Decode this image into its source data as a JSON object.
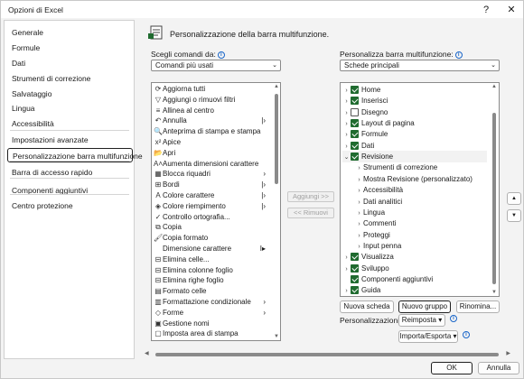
{
  "window": {
    "title": "Opzioni di Excel",
    "help_glyph": "?",
    "close_glyph": "✕"
  },
  "sidebar": {
    "items": [
      {
        "label": "Generale"
      },
      {
        "label": "Formule"
      },
      {
        "label": "Dati"
      },
      {
        "label": "Strumenti di correzione"
      },
      {
        "label": "Salvataggio"
      },
      {
        "label": "Lingua"
      },
      {
        "label": "Accessibilità"
      },
      {
        "label": "Impostazioni avanzate"
      },
      {
        "label": "Personalizzazione barra multifunzione"
      },
      {
        "label": "Barra di accesso rapido"
      },
      {
        "label": "Componenti aggiuntivi"
      },
      {
        "label": "Centro protezione"
      }
    ],
    "active_index": 8
  },
  "main": {
    "header": "Personalizzazione della barra multifunzione.",
    "left": {
      "label": "Scegli comandi da:",
      "combo_value": "Comandi più usati",
      "commands": [
        {
          "label": "Aggiorna tutti",
          "icon": "refresh-icon",
          "glyph": "⟳"
        },
        {
          "label": "Aggiungi o rimuovi filtri",
          "icon": "filter-icon",
          "glyph": "▽"
        },
        {
          "label": "Allinea al centro",
          "icon": "align-center-icon",
          "glyph": "≡"
        },
        {
          "label": "Annulla",
          "icon": "undo-icon",
          "glyph": "↶",
          "sub": "|›"
        },
        {
          "label": "Anteprima di stampa e stampa",
          "icon": "print-preview-icon",
          "glyph": "🔍"
        },
        {
          "label": "Apice",
          "icon": "superscript-icon",
          "glyph": "x²"
        },
        {
          "label": "Apri",
          "icon": "folder-icon",
          "glyph": "📂"
        },
        {
          "label": "Aumenta dimensioni carattere",
          "icon": "font-grow-icon",
          "glyph": "A˄"
        },
        {
          "label": "Blocca riquadri",
          "icon": "freeze-panes-icon",
          "glyph": "▦",
          "sub": "›"
        },
        {
          "label": "Bordi",
          "icon": "borders-icon",
          "glyph": "⊞",
          "sub": "|›"
        },
        {
          "label": "Colore carattere",
          "icon": "font-color-icon",
          "glyph": "A",
          "sub": "|›"
        },
        {
          "label": "Colore riempimento",
          "icon": "fill-color-icon",
          "glyph": "◈",
          "sub": "|›"
        },
        {
          "label": "Controllo ortografia...",
          "icon": "spelling-icon",
          "glyph": "✓"
        },
        {
          "label": "Copia",
          "icon": "copy-icon",
          "glyph": "⧉"
        },
        {
          "label": "Copia formato",
          "icon": "format-painter-icon",
          "glyph": "🖌"
        },
        {
          "label": "Dimensione carattere",
          "icon": "",
          "glyph": "",
          "sub": "I▸"
        },
        {
          "label": "Elimina celle...",
          "icon": "delete-cells-icon",
          "glyph": "⊟"
        },
        {
          "label": "Elimina colonne foglio",
          "icon": "delete-columns-icon",
          "glyph": "⊟"
        },
        {
          "label": "Elimina righe foglio",
          "icon": "delete-rows-icon",
          "glyph": "⊟"
        },
        {
          "label": "Formato celle",
          "icon": "format-cells-icon",
          "glyph": "▤"
        },
        {
          "label": "Formattazione condizionale",
          "icon": "conditional-format-icon",
          "glyph": "▥",
          "sub": "›"
        },
        {
          "label": "Forme",
          "icon": "shapes-icon",
          "glyph": "◇",
          "sub": "›"
        },
        {
          "label": "Gestione nomi",
          "icon": "name-manager-icon",
          "glyph": "▣"
        },
        {
          "label": "Imposta area di stampa",
          "icon": "print-area-icon",
          "glyph": "▢"
        }
      ]
    },
    "mid": {
      "add_label": "Aggiungi >>",
      "remove_label": "<< Rimuovi"
    },
    "right": {
      "label": "Personalizza barra multifunzione:",
      "combo_value": "Schede principali",
      "tree": [
        {
          "label": "Home",
          "checked": true,
          "level": 0,
          "exp": "›"
        },
        {
          "label": "Inserisci",
          "checked": true,
          "level": 0,
          "exp": "›"
        },
        {
          "label": "Disegno",
          "checked": false,
          "level": 0,
          "exp": "›"
        },
        {
          "label": "Layout di pagina",
          "checked": true,
          "level": 0,
          "exp": "›"
        },
        {
          "label": "Formule",
          "checked": true,
          "level": 0,
          "exp": "›"
        },
        {
          "label": "Dati",
          "checked": true,
          "level": 0,
          "exp": "›"
        },
        {
          "label": "Revisione",
          "checked": true,
          "level": 0,
          "exp": "⌄",
          "selected": true
        },
        {
          "label": "Strumenti di correzione",
          "level": 1,
          "exp": "›"
        },
        {
          "label": "Mostra Revisione (personalizzato)",
          "level": 1,
          "exp": "›"
        },
        {
          "label": "Accessibilità",
          "level": 1,
          "exp": "›"
        },
        {
          "label": "Dati analitici",
          "level": 1,
          "exp": "›"
        },
        {
          "label": "Lingua",
          "level": 1,
          "exp": "›"
        },
        {
          "label": "Commenti",
          "level": 1,
          "exp": "›"
        },
        {
          "label": "Proteggi",
          "level": 1,
          "exp": "›"
        },
        {
          "label": "Input penna",
          "level": 1,
          "exp": "›"
        },
        {
          "label": "Visualizza",
          "checked": true,
          "level": 0,
          "exp": "›"
        },
        {
          "label": "Sviluppo",
          "checked": true,
          "level": 0,
          "exp": "›"
        },
        {
          "label": "Componenti aggiuntivi",
          "checked": true,
          "level": 0,
          "exp": ""
        },
        {
          "label": "Guida",
          "checked": true,
          "level": 0,
          "exp": "›"
        }
      ],
      "new_tab": "Nuova scheda",
      "new_group": "Nuovo gruppo",
      "rename": "Rinomina...",
      "custom_label": "Personalizzazioni:",
      "reset": "Reimposta ▾",
      "import_export": "Importa/Esporta ▾"
    }
  },
  "footer": {
    "ok": "OK",
    "cancel": "Annulla"
  },
  "colors": {
    "check": "#1f6b2f",
    "info": "#1a66c9"
  }
}
